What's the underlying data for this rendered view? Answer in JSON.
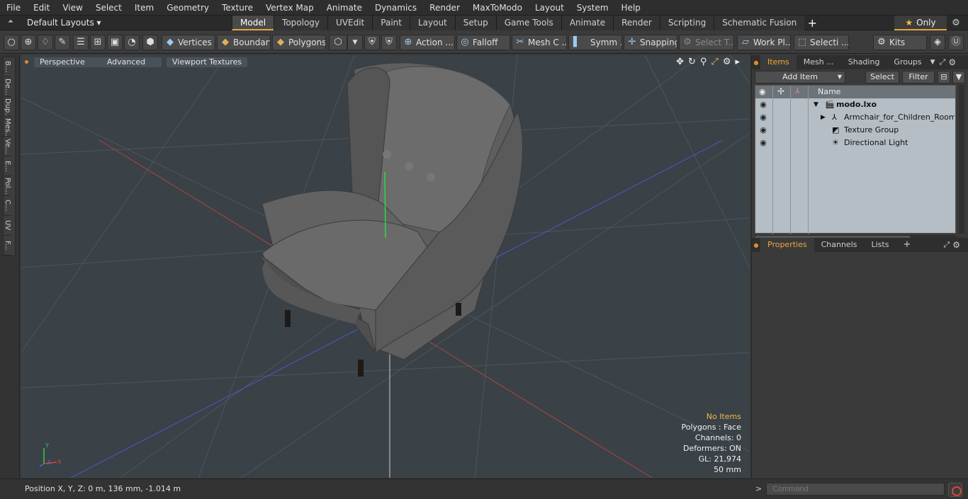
{
  "menu": [
    "File",
    "Edit",
    "View",
    "Select",
    "Item",
    "Geometry",
    "Texture",
    "Vertex Map",
    "Animate",
    "Dynamics",
    "Render",
    "MaxToModo",
    "Layout",
    "System",
    "Help"
  ],
  "layout": {
    "default_layouts": "Default Layouts ▾",
    "tabs": [
      "Model",
      "Topology",
      "UVEdit",
      "Paint",
      "Layout",
      "Setup",
      "Game Tools",
      "Animate",
      "Render",
      "Scripting",
      "Schematic Fusion"
    ],
    "active_tab": "Model",
    "only_label": "Only"
  },
  "toolbar": {
    "vertices": "Vertices",
    "boundary": "Boundary",
    "polygons": "Polygons",
    "action": "Action ...",
    "falloff": "Falloff",
    "mesh_c": "Mesh C ...",
    "symm": "Symm ...",
    "snapping": "Snapping",
    "select_t": "Select T...",
    "work_pl": "Work Pl...",
    "selecti": "Selecti ...",
    "kits": "Kits"
  },
  "left_tabs": [
    "B...",
    "De...",
    "Dup...",
    "Mes...",
    "Ve...",
    "E...",
    "Pol...",
    "C...",
    "UV",
    "F..."
  ],
  "viewport": {
    "perspective": "Perspective",
    "advanced": "Advanced",
    "viewport_textures": "Viewport Textures",
    "info": {
      "no_items": "No Items",
      "polygons": "Polygons : Face",
      "channels": "Channels: 0",
      "deformers": "Deformers: ON",
      "gl": "GL: 21,974",
      "size": "50 mm"
    },
    "gizmo": {
      "y": "Y",
      "x": "X",
      "z": "Z"
    }
  },
  "items_panel": {
    "tabs": [
      "Items",
      "Mesh ...",
      "Shading",
      "Groups"
    ],
    "active_tab": "Items",
    "add_item": "Add Item",
    "select": "Select",
    "filter": "Filter",
    "column_name": "Name",
    "rows": [
      {
        "label": "modo.lxo",
        "icon": "scene-icon"
      },
      {
        "label": "Armchair_for_Children_Room ...",
        "icon": "mesh-icon"
      },
      {
        "label": "Texture Group",
        "icon": "texture-group-icon"
      },
      {
        "label": "Directional Light",
        "icon": "light-icon"
      }
    ]
  },
  "properties_panel": {
    "tabs": [
      "Properties",
      "Channels",
      "Lists"
    ],
    "active_tab": "Properties"
  },
  "status": {
    "position": "Position X, Y, Z:   0 m, 136 mm, -1.014 m",
    "command_placeholder": "Command"
  }
}
